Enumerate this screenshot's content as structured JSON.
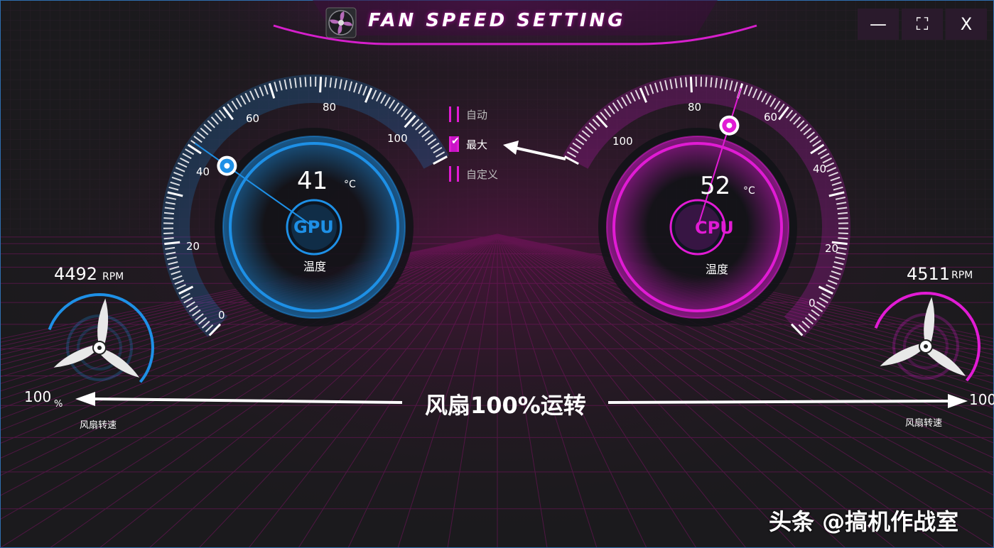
{
  "window": {
    "title": "FAN SPEED SETTING",
    "controls": {
      "minimize": "—",
      "maximize": "⛶",
      "close": "X"
    }
  },
  "gpu": {
    "chip": "GPU",
    "temperature": "41",
    "unit": "°C",
    "temp_label": "温度",
    "needle_value": 41,
    "ticks": [
      "0",
      "20",
      "40",
      "60",
      "80",
      "100"
    ],
    "color": "#1e90e6"
  },
  "cpu": {
    "chip": "CPU",
    "temperature": "52",
    "unit": "°C",
    "temp_label": "温度",
    "needle_value": 60,
    "ticks": [
      "0",
      "20",
      "40",
      "60",
      "80",
      "100"
    ],
    "color": "#e11bd4"
  },
  "modes": [
    {
      "label": "自动",
      "checked": false
    },
    {
      "label": "最大",
      "checked": true
    },
    {
      "label": "自定义",
      "checked": false
    }
  ],
  "fans": {
    "left": {
      "rpm": "4492",
      "rpm_unit": "RPM",
      "percent": "100",
      "percent_unit": "%",
      "label": "风扇转速"
    },
    "right": {
      "rpm": "4511",
      "rpm_unit": "RPM",
      "percent": "100",
      "label": "风扇转速"
    }
  },
  "annotation": "风扇100%运转",
  "watermark": "头条 @搞机作战室"
}
